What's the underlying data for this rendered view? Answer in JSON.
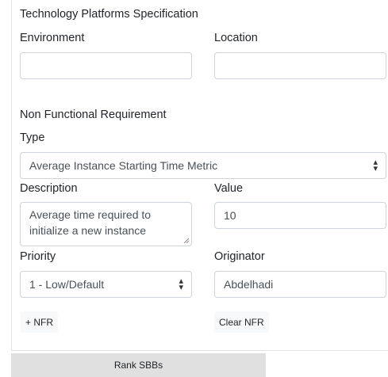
{
  "section_title": "Technology Platforms Specification",
  "environment": {
    "label": "Environment",
    "value": ""
  },
  "location": {
    "label": "Location",
    "value": ""
  },
  "nfr": {
    "heading": "Non Functional Requirement",
    "type_label": "Type",
    "type_selected": "Average Instance Starting Time Metric",
    "description_label": "Description",
    "description_value": "Average time required to initialize a new instance",
    "value_label": "Value",
    "value_value": "10",
    "priority_label": "Priority",
    "priority_selected": "1 - Low/Default",
    "originator_label": "Originator",
    "originator_value": "Abdelhadi"
  },
  "buttons": {
    "add_nfr": "+ NFR",
    "clear_nfr": "Clear NFR",
    "rank_sbbs": "Rank SBBs"
  },
  "icons": {
    "select_arrows": "sort-arrows-icon",
    "resize": "resize-grip-icon"
  }
}
